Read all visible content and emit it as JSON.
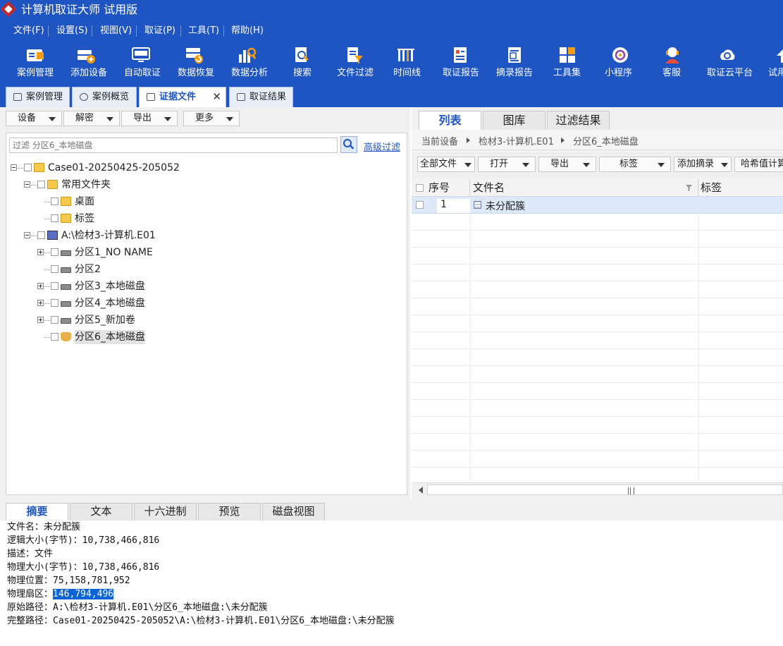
{
  "app": {
    "title": "计算机取证大师 试用版"
  },
  "menu": [
    "文件(F)",
    "设置(S)",
    "视图(V)",
    "取证(P)",
    "工具(T)",
    "帮助(H)"
  ],
  "toolbar": [
    {
      "label": "案例管理",
      "icon": "case-folder-icon"
    },
    {
      "label": "添加设备",
      "icon": "add-device-icon"
    },
    {
      "label": "自动取证",
      "icon": "auto-monitor-icon"
    },
    {
      "label": "数据恢复",
      "icon": "data-recovery-icon"
    },
    {
      "label": "数据分析",
      "icon": "data-analysis-icon"
    },
    {
      "label": "搜索",
      "icon": "search-doc-icon"
    },
    {
      "label": "文件过滤",
      "icon": "file-filter-icon"
    },
    {
      "label": "时间线",
      "icon": "timeline-icon"
    },
    {
      "label": "取证报告",
      "icon": "report-icon"
    },
    {
      "label": "摘录报告",
      "icon": "excerpt-report-icon"
    },
    {
      "label": "工具集",
      "icon": "toolset-grid-icon"
    },
    {
      "label": "小程序",
      "icon": "mini-program-icon"
    },
    {
      "label": "客服",
      "icon": "customer-service-icon"
    },
    {
      "label": "取证云平台",
      "icon": "cloud-platform-icon"
    },
    {
      "label": "试用",
      "icon": "trial-icon"
    }
  ],
  "doc_tabs": [
    {
      "label": "案例管理"
    },
    {
      "label": "案例概览"
    },
    {
      "label": "证据文件",
      "active": true
    },
    {
      "label": "取证结果"
    }
  ],
  "left": {
    "buttons": [
      "设备",
      "解密",
      "导出",
      "更多"
    ],
    "filter_placeholder": "过滤 分区6_本地磁盘",
    "advanced_filter": "高级过滤",
    "tree": [
      {
        "label": "Case01-20250425-205052"
      },
      {
        "label": "常用文件夹"
      },
      {
        "label": "桌面"
      },
      {
        "label": "标签"
      },
      {
        "label": "A:\\检材3-计算机.E01"
      },
      {
        "label": "分区1_NO NAME"
      },
      {
        "label": "分区2"
      },
      {
        "label": "分区3_本地磁盘"
      },
      {
        "label": "分区4_本地磁盘"
      },
      {
        "label": "分区5_新加卷"
      },
      {
        "label": "分区6_本地磁盘"
      }
    ]
  },
  "right": {
    "tabs": [
      "列表",
      "图库",
      "过滤结果"
    ],
    "breadcrumb": [
      "当前设备",
      "检材3-计算机.E01",
      "分区6_本地磁盘"
    ],
    "buttons": [
      "全部文件",
      "打开",
      "导出",
      "标签",
      "添加摘录",
      "哈希值计算"
    ],
    "columns": [
      "序号",
      "文件名",
      "标签"
    ],
    "rows": [
      {
        "index": "1",
        "name": "未分配簇",
        "tag": ""
      }
    ]
  },
  "bottom": {
    "tabs": [
      "摘要",
      "文本",
      "十六进制",
      "预览",
      "磁盘视图"
    ],
    "props": [
      {
        "label": "文件名：",
        "value": "未分配簇"
      },
      {
        "label": "逻辑大小(字节)：",
        "value": "10,738,466,816"
      },
      {
        "label": "描述：",
        "value": "文件"
      },
      {
        "label": "物理大小(字节)：",
        "value": "10,738,466,816"
      },
      {
        "label": "物理位置：",
        "value": "75,158,781,952"
      },
      {
        "label": "物理扇区：",
        "value": "146,794,496"
      },
      {
        "label": "原始路径：",
        "value": "A:\\检材3-计算机.E01\\分区6_本地磁盘:\\未分配簇"
      },
      {
        "label": "完整路径：",
        "value": "Case01-20250425-205052\\A:\\检材3-计算机.E01\\分区6_本地磁盘:\\未分配簇"
      }
    ]
  },
  "colors": {
    "brand_blue": "#1e55c2",
    "selection": "#0a64d6"
  }
}
